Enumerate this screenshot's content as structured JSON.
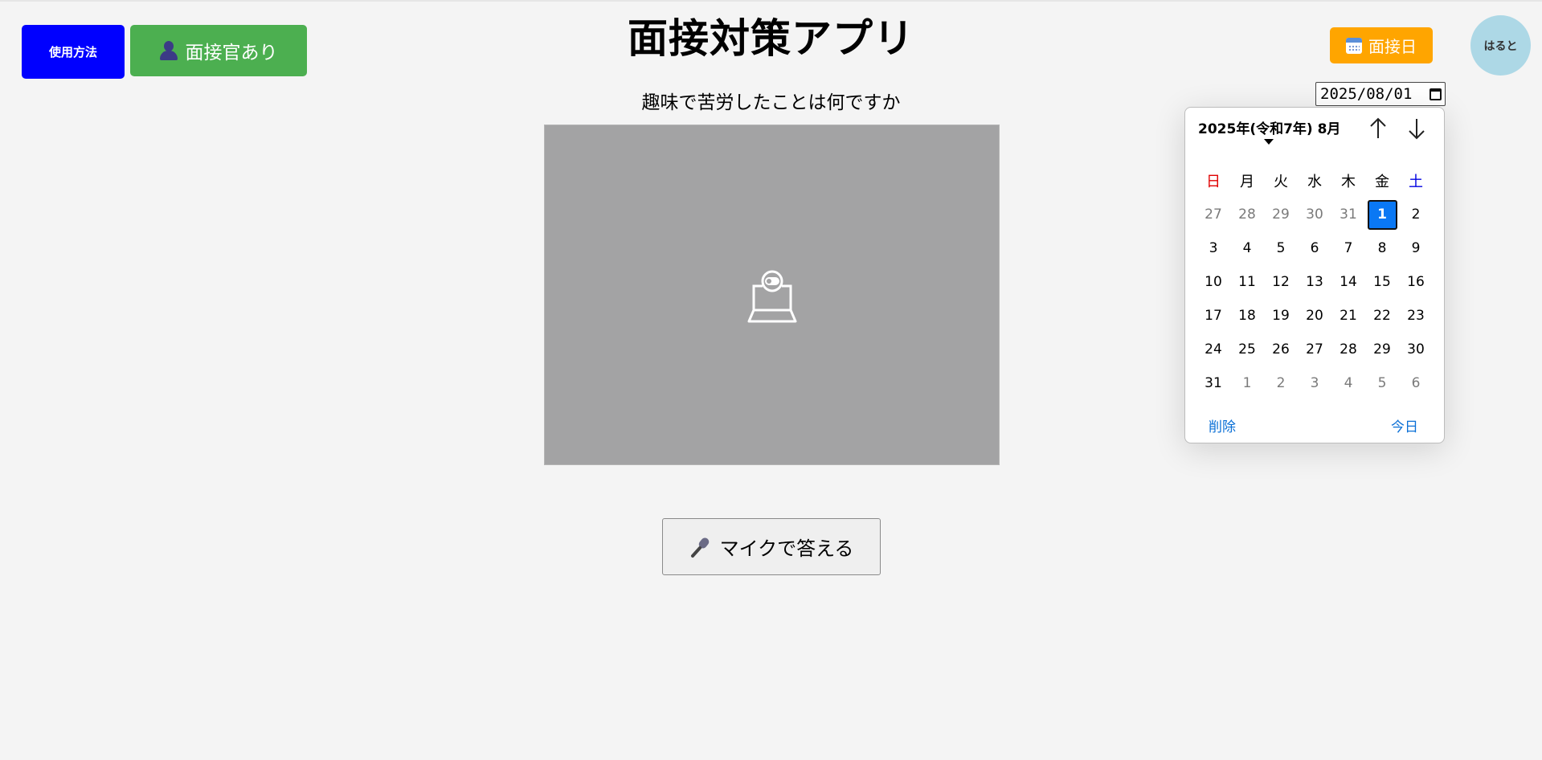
{
  "header": {
    "usage_button": "使用方法",
    "interviewer_button": "面接官あり",
    "title": "面接対策アプリ",
    "interview_date_button": "面接日",
    "avatar_name": "はると"
  },
  "question": "趣味で苦労したことは何ですか",
  "date_input": {
    "value": "2025/08/01"
  },
  "calendar": {
    "header": "2025年(令和7年) 8月",
    "weekdays": [
      "日",
      "月",
      "火",
      "水",
      "木",
      "金",
      "土"
    ],
    "days": [
      [
        "27",
        "28",
        "29",
        "30",
        "31",
        "1",
        "2"
      ],
      [
        "3",
        "4",
        "5",
        "6",
        "7",
        "8",
        "9"
      ],
      [
        "10",
        "11",
        "12",
        "13",
        "14",
        "15",
        "16"
      ],
      [
        "17",
        "18",
        "19",
        "20",
        "21",
        "22",
        "23"
      ],
      [
        "24",
        "25",
        "26",
        "27",
        "28",
        "29",
        "30"
      ],
      [
        "31",
        "1",
        "2",
        "3",
        "4",
        "5",
        "6"
      ]
    ],
    "selected_day": "1",
    "clear_label": "削除",
    "today_label": "今日"
  },
  "mic_button": "マイクで答える",
  "colors": {
    "usage_button": "#0000ff",
    "interviewer_button": "#4caf50",
    "interview_date_button": "#ffa500",
    "avatar": "#add8e6",
    "selected_day": "#0a78f4",
    "video_placeholder": "#a3a3a4"
  },
  "icons": [
    "person-icon",
    "calendar-icon",
    "camera-off-icon",
    "microphone-icon",
    "arrow-up-icon",
    "arrow-down-icon",
    "caret-down-icon"
  ]
}
